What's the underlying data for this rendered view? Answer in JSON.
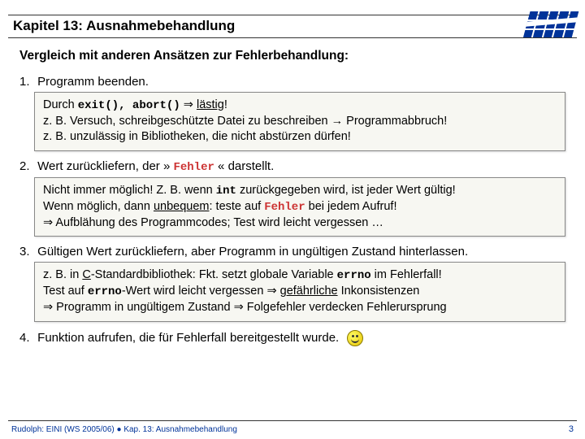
{
  "title": "Kapitel 13: Ausnahmebehandlung",
  "subtitle": "Vergleich mit anderen Ansätzen zur Fehlerbehandlung:",
  "items": [
    {
      "num": "1.",
      "head": "Programm beenden.",
      "box": {
        "l1a": "Durch ",
        "l1code": "exit(), abort()",
        "l1b": " ⇒ ",
        "l1u": "lästig",
        "l1c": "!",
        "l2": "z. B. Versuch, schreibgeschützte Datei zu beschreiben → Programmabbruch!",
        "l3": "z. B. unzulässig in Bibliotheken, die nicht abstürzen dürfen!"
      }
    },
    {
      "num": "2.",
      "head_a": "Wert zurückliefern, der  » ",
      "head_code": "Fehler",
      "head_b": " «  darstellt.",
      "box": {
        "l1a": "Nicht immer möglich! Z. B. wenn ",
        "l1code": "int",
        "l1b": " zurückgegeben wird, ist jeder Wert gültig!",
        "l2a": "Wenn möglich, dann ",
        "l2u": "unbequem",
        "l2b": ": teste auf ",
        "l2code": "Fehler",
        "l2c": " bei jedem Aufruf!",
        "l3": "⇒ Aufblähung des Programmcodes; Test wird leicht vergessen …"
      }
    },
    {
      "num": "3.",
      "head": "Gültigen Wert zurückliefern, aber Programm in ungültigen Zustand hinterlassen.",
      "box": {
        "l1a": "z. B. in ",
        "l1u": "C",
        "l1b": "-Standardbibliothek: Fkt. setzt globale Variable ",
        "l1code": "errno",
        "l1c": " im Fehlerfall!",
        "l2a": "Test auf ",
        "l2code": "errno",
        "l2b": "-Wert wird leicht vergessen ⇒ ",
        "l2u": "gefährliche",
        "l2c": " Inkonsistenzen",
        "l3": "⇒ Programm in ungültigem Zustand ⇒ Folgefehler verdecken Fehlerursprung"
      }
    },
    {
      "num": "4.",
      "head": "Funktion aufrufen, die für Fehlerfall bereitgestellt wurde."
    }
  ],
  "footer": {
    "left": "Rudolph: EINI (WS 2005/06) ● Kap. 13: Ausnahmebehandlung",
    "right": "3"
  }
}
